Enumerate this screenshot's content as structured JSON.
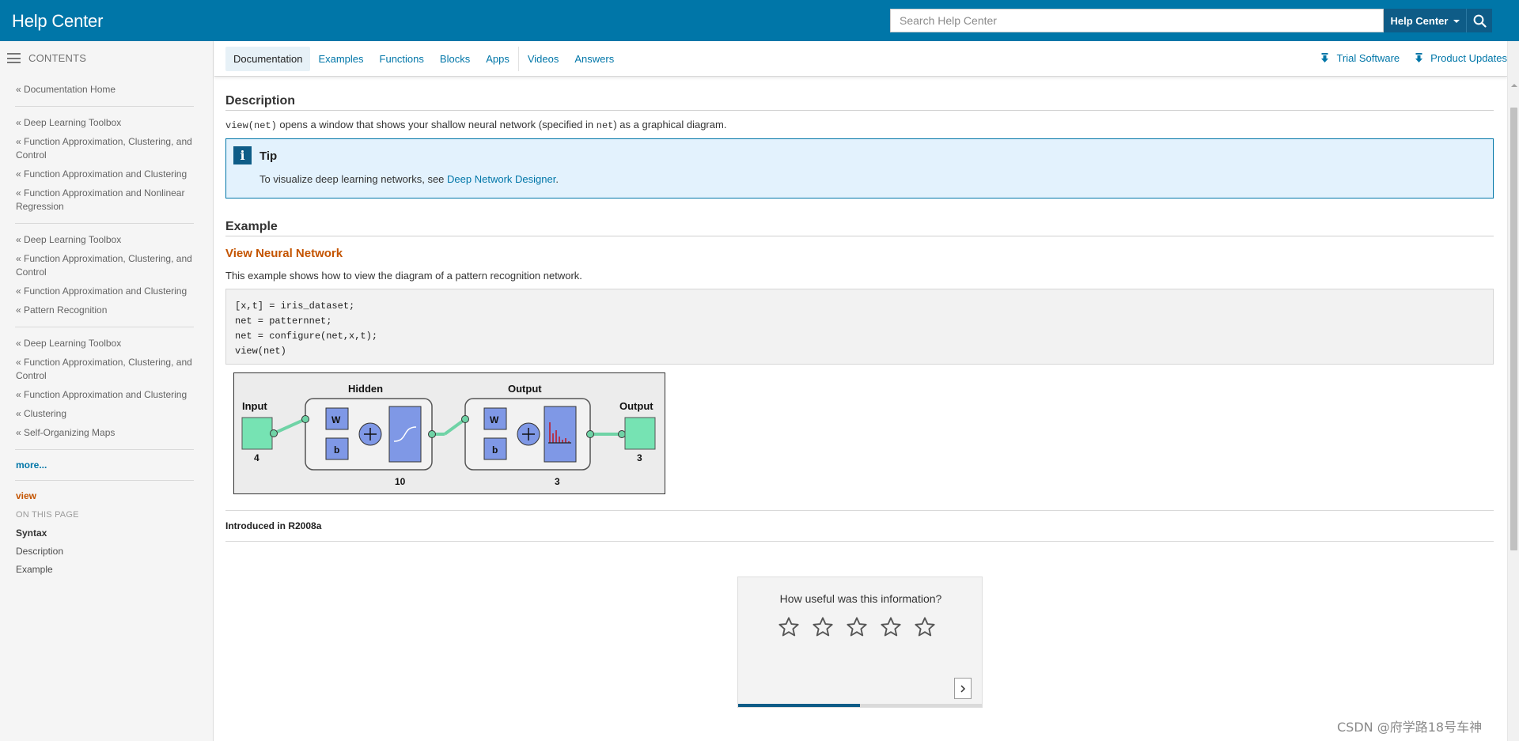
{
  "header": {
    "brand": "Help Center",
    "search_placeholder": "Search Help Center",
    "search_scope": "Help Center"
  },
  "sidebar": {
    "contents_label": "CONTENTS",
    "groups": [
      [
        "« Documentation Home"
      ],
      [
        "« Deep Learning Toolbox",
        "« Function Approximation, Clustering, and Control",
        "« Function Approximation and Clustering",
        "« Function Approximation and Nonlinear Regression"
      ],
      [
        "« Deep Learning Toolbox",
        "« Function Approximation, Clustering, and Control",
        "« Function Approximation and Clustering",
        "« Pattern Recognition"
      ],
      [
        "« Deep Learning Toolbox",
        "« Function Approximation, Clustering, and Control",
        "« Function Approximation and Clustering",
        "« Clustering",
        "« Self-Organizing Maps"
      ]
    ],
    "more": "more...",
    "current": "view",
    "on_this_page": "ON THIS PAGE",
    "page_links": [
      "Syntax",
      "Description",
      "Example"
    ]
  },
  "tabs": [
    "Documentation",
    "Examples",
    "Functions",
    "Blocks",
    "Apps",
    "Videos",
    "Answers"
  ],
  "util_links": {
    "trial": "Trial Software",
    "updates": "Product Updates"
  },
  "description": {
    "heading": "Description",
    "code_call": "view(net)",
    "text_1": " opens a window that shows your shallow neural network (specified in ",
    "code_net": "net",
    "text_2": ") as a graphical diagram."
  },
  "tip": {
    "title": "Tip",
    "text": "To visualize deep learning networks, see ",
    "link": "Deep Network Designer",
    "end": "."
  },
  "example": {
    "heading": "Example",
    "subheading": "View Neural Network",
    "text": "This example shows how to view the diagram of a pattern recognition network.",
    "code": [
      "[x,t] = iris_dataset;",
      "net = patternnet;",
      "net = configure(net,x,t);",
      "view(net)"
    ]
  },
  "diagram": {
    "input_label": "Input",
    "input_size": "4",
    "hidden_label": "Hidden",
    "hidden_size": "10",
    "output_layer_label": "Output",
    "output_layer_size": "3",
    "output_label": "Output",
    "output_size": "3",
    "weight_label": "W",
    "bias_label": "b"
  },
  "introduced": "Introduced in R2008a",
  "rating": {
    "question": "How useful was this information?",
    "progress": 0.5
  },
  "watermark": "CSDN @府学路18号车神",
  "colors": {
    "brand_blue": "#0076a8",
    "dark_blue": "#0e5c87",
    "accent_orange": "#c45400",
    "tip_bg": "#e3f2fd"
  }
}
